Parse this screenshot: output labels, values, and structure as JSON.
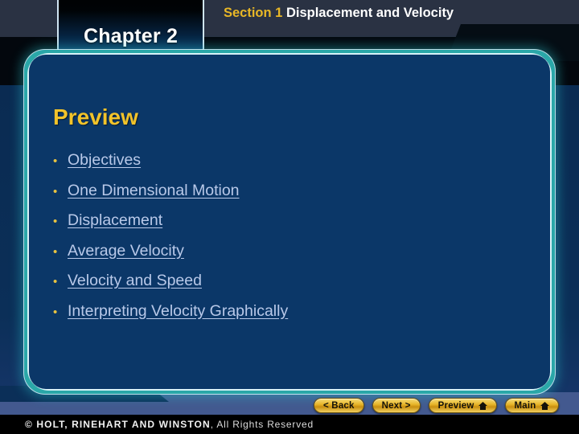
{
  "slide": {
    "chapter_badge": "Chapter 2",
    "section_label": "Section 1",
    "section_title": "Displacement and Velocity",
    "heading": "Preview",
    "bullet_glyph": "•"
  },
  "preview_links": [
    {
      "label": "Objectives"
    },
    {
      "label": "One Dimensional Motion"
    },
    {
      "label": "Displacement"
    },
    {
      "label": "Average Velocity"
    },
    {
      "label": "Velocity and Speed"
    },
    {
      "label": "Interpreting Velocity Graphically"
    }
  ],
  "nav_buttons": [
    {
      "label": "< Back",
      "icon": ""
    },
    {
      "label": "Next >",
      "icon": ""
    },
    {
      "label": "Preview",
      "icon": "home-icon"
    },
    {
      "label": "Main",
      "icon": "home-icon"
    }
  ],
  "footer": {
    "copyright_mark": "© ",
    "publisher": "HOLT, RINEHART AND WINSTON",
    "rights": ", All Rights Reserved"
  },
  "colors": {
    "header_bg": "#2a3243",
    "panel_bg": "#0b3768",
    "panel_glow": "#2aa7a8",
    "accent_gold": "#f2c32a",
    "section_gold": "#e8b726",
    "link_blue": "#b9c9e9",
    "button_gold": "#e8b62a",
    "backdrop_blue": "#0b2f58"
  }
}
